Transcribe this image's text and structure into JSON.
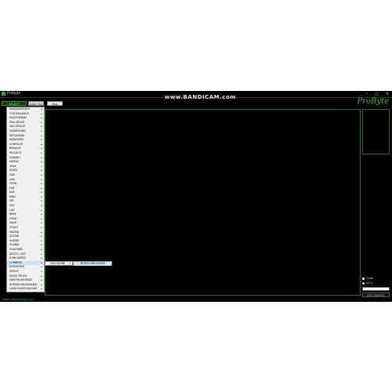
{
  "window": {
    "title": "ProByte",
    "watermark": "www.BANDICAM.com",
    "minimize": "–",
    "maximize": "□",
    "close": "✕"
  },
  "toolbar": {
    "ecu_label": "SELECT ECU(ECU)",
    "save_label": "SAVE FILE",
    "hex_label": "Hex Viewer"
  },
  "logo": "ProByte",
  "menu": {
    "items": [
      "NISSAN/INFINITI",
      "TOYOTA/LEXUS",
      "KIA/HYUNDAI",
      "PSA GROUP",
      "VAG GROUP",
      "SSANGYONG",
      "MITSUBISHI",
      "MERCEDES",
      "CHRYSLER",
      "RENAULT",
      "PEUGEOT",
      "SUBARU",
      "KAMAZ",
      "URAL",
      "ISUZU",
      "GAZ",
      "UAZ",
      "FORD",
      "FIAT",
      "DAF",
      "MAN",
      "GM",
      "VAZ",
      "LAZ",
      "BMW",
      "FORD",
      "VAAZ",
      "VOLVO",
      "MAZDA",
      "SUZUKI",
      "SUZUKI",
      "SCANIA",
      "SHACMAN",
      "DEUTZ / KET",
      "JOHN DEERE",
      "CUMMINS",
      "DONGFENG",
      "SISSUS",
      "ISUZU TRUCK",
      "SINOTRUK/HOWO",
      "ZHONGXUN/SHAANXI",
      "LAND ROVER/JAGUAR"
    ],
    "active_index": 35
  },
  "submenu1": {
    "label": "CASCADINE"
  },
  "submenu2": {
    "label": "BOSCH MD1CE100"
  },
  "side": {
    "radio1": "Code",
    "radio2": "all H",
    "search_placeholder": "",
    "search_button": "DTC SEARCH"
  },
  "footer": {
    "link": "https://sellrucklog.com"
  }
}
